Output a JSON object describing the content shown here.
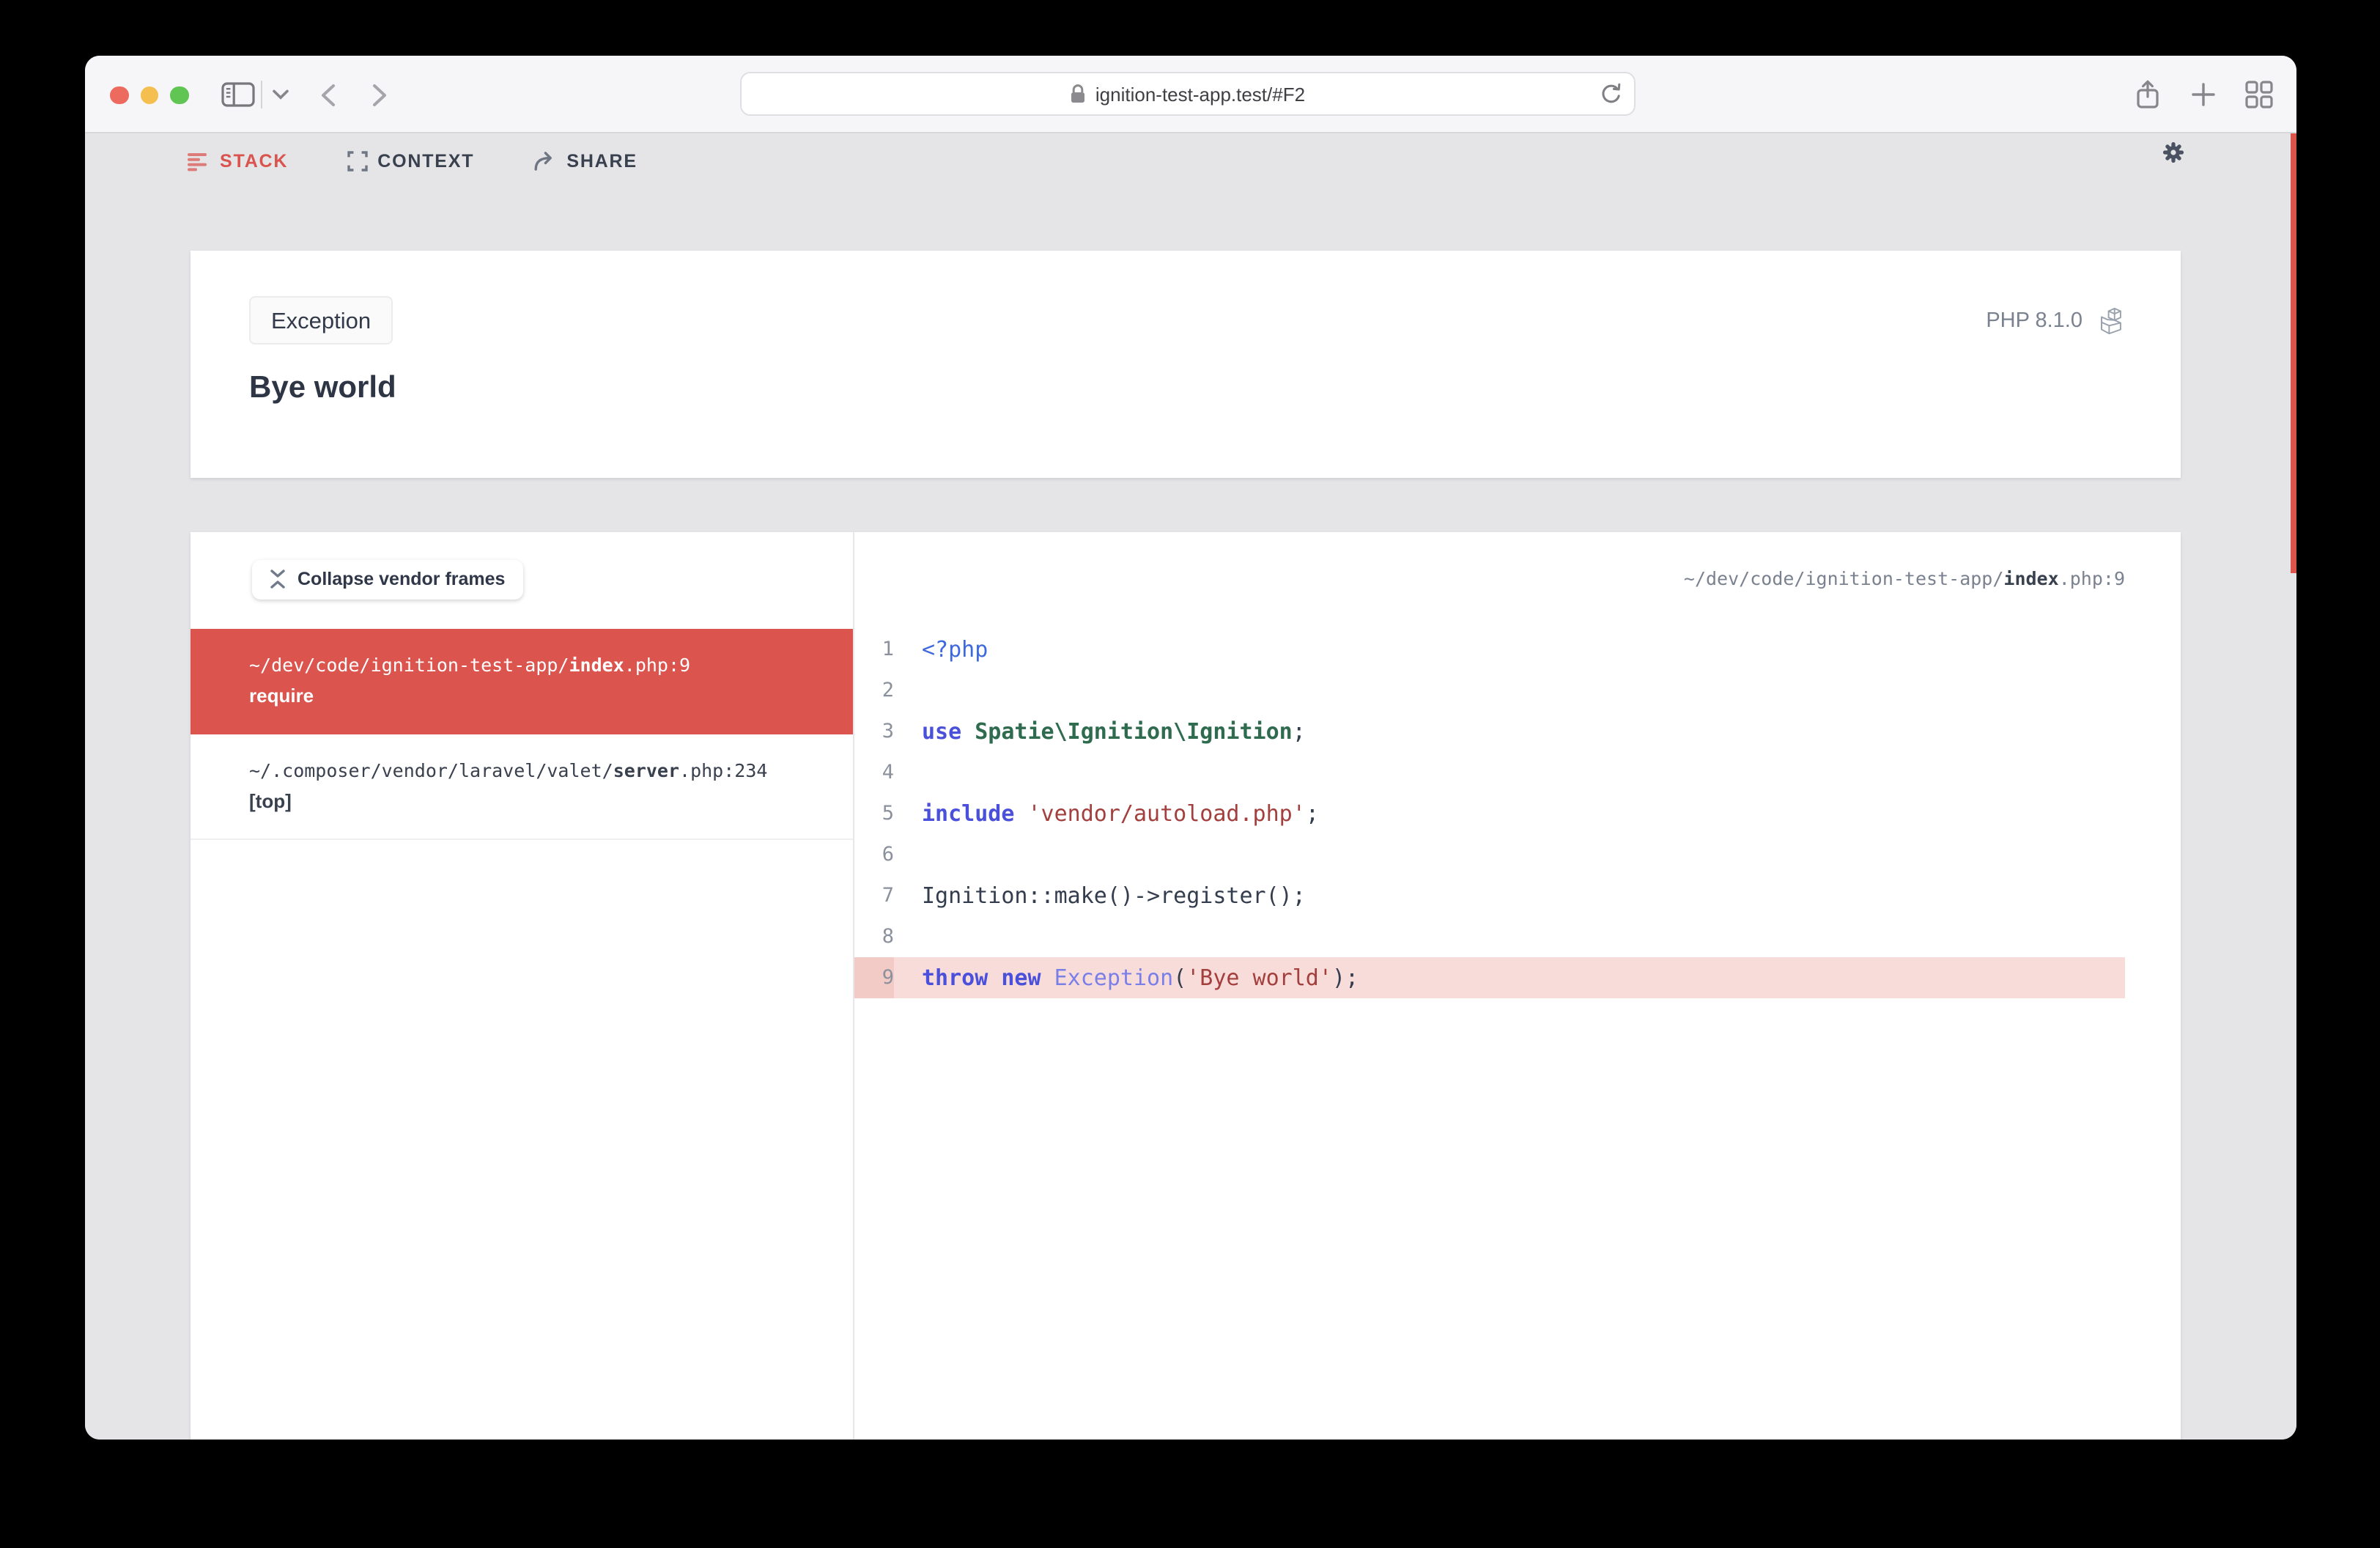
{
  "browser": {
    "url": "ignition-test-app.test/#F2"
  },
  "nav": {
    "tabs": [
      {
        "label": "STACK",
        "active": true
      },
      {
        "label": "CONTEXT",
        "active": false
      },
      {
        "label": "SHARE",
        "active": false
      }
    ]
  },
  "error_card": {
    "badge": "Exception",
    "message": "Bye world",
    "php_version": "PHP 8.1.0"
  },
  "stack": {
    "collapse_button": "Collapse vendor frames",
    "frames": [
      {
        "path_prefix": "~/dev/code/ignition-test-app/",
        "file": "index",
        "ext": ".php",
        "line": ":9",
        "method": "require"
      },
      {
        "path_prefix": "~/.composer/vendor/laravel/valet/",
        "file": "server",
        "ext": ".php",
        "line": ":234",
        "method": "[top]"
      }
    ]
  },
  "code": {
    "file_header": {
      "prefix": "~/dev/code/ignition-test-app/",
      "file": "index",
      "suffix": ".php:9"
    },
    "highlight_line": 9,
    "lines": [
      {
        "n": 1,
        "tokens": [
          [
            "tag",
            "<?php"
          ]
        ]
      },
      {
        "n": 2,
        "tokens": []
      },
      {
        "n": 3,
        "tokens": [
          [
            "kw",
            "use"
          ],
          [
            "plain",
            " "
          ],
          [
            "cls",
            "Spatie\\Ignition\\Ignition"
          ],
          [
            "plain",
            ";"
          ]
        ]
      },
      {
        "n": 4,
        "tokens": []
      },
      {
        "n": 5,
        "tokens": [
          [
            "kw",
            "include"
          ],
          [
            "plain",
            " "
          ],
          [
            "str",
            "'vendor/autoload.php'"
          ],
          [
            "plain",
            ";"
          ]
        ]
      },
      {
        "n": 6,
        "tokens": []
      },
      {
        "n": 7,
        "tokens": [
          [
            "plain",
            "Ignition::make()->register();"
          ]
        ]
      },
      {
        "n": 8,
        "tokens": []
      },
      {
        "n": 9,
        "tokens": [
          [
            "kw",
            "throw"
          ],
          [
            "plain",
            " "
          ],
          [
            "kw",
            "new"
          ],
          [
            "plain",
            " "
          ],
          [
            "cls2",
            "Exception"
          ],
          [
            "plain",
            "("
          ],
          [
            "str",
            "'Bye world'"
          ],
          [
            "plain",
            ");"
          ]
        ]
      }
    ]
  },
  "colors": {
    "accent_red": "#DB544E",
    "highlight_row": "#F8DCDA",
    "highlight_gutter": "#F2CBC7",
    "page_bg": "#E5E4E7"
  }
}
